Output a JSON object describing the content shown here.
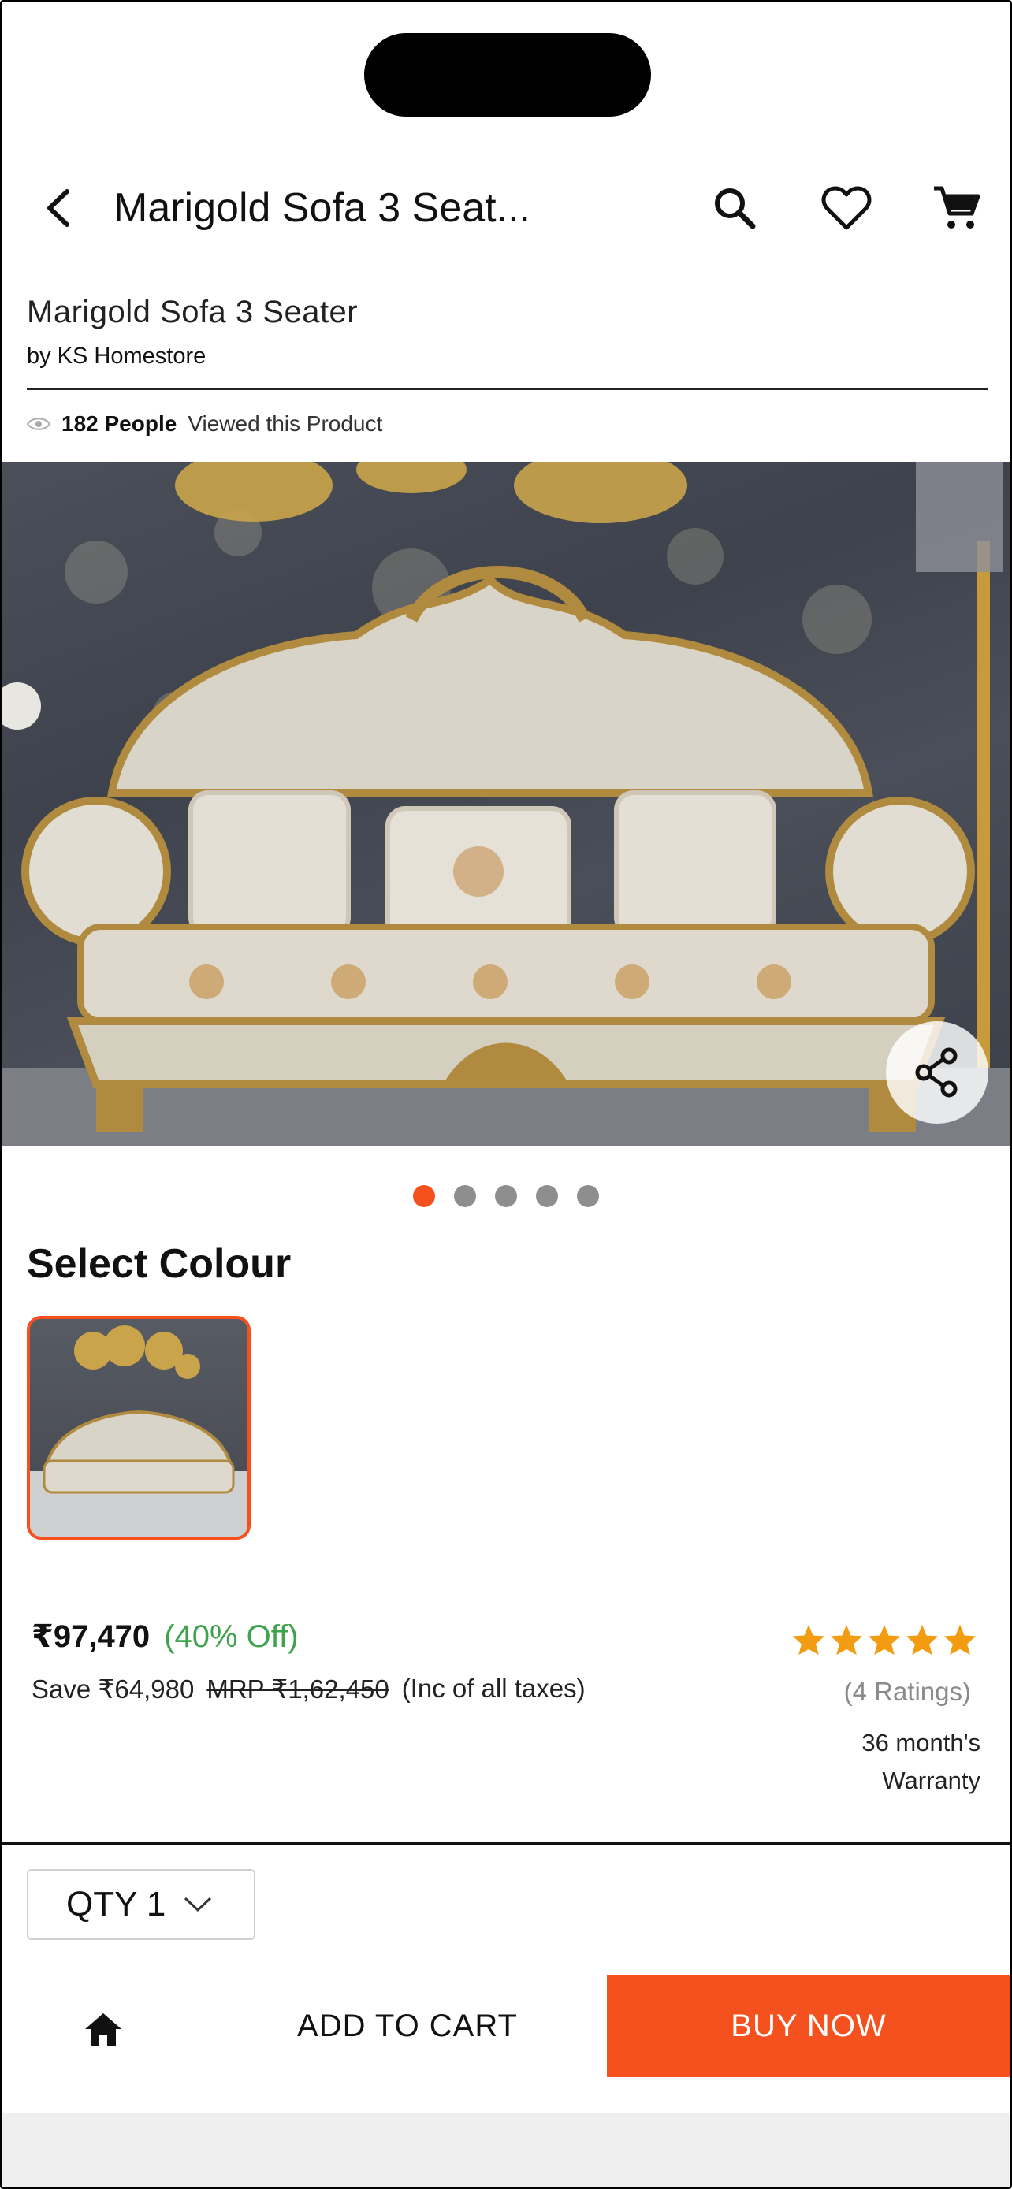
{
  "header": {
    "title": "Marigold Sofa 3 Seat...",
    "icons": [
      "back-arrow-icon",
      "search-icon",
      "heart-icon",
      "cart-icon"
    ]
  },
  "product": {
    "name": "Marigold Sofa 3 Seater",
    "brand": "by KS Homestore",
    "viewers_count": "182 People",
    "viewers_text": "Viewed this Product"
  },
  "gallery": {
    "image_description": "Ornate carved gold-trim 3-seater sofa with cream damask upholstery and three cushions against a dark textured wall",
    "total_images": 5,
    "active_index": 0
  },
  "colour": {
    "title": "Select Colour",
    "selected_index": 0
  },
  "pricing": {
    "price": "₹97,470",
    "discount": "(40% Off)",
    "save": "Save ₹64,980",
    "mrp": "MRP ₹1,62,450",
    "tax_note": "(Inc of all taxes)",
    "rating_stars": 5,
    "ratings_text": "(4 Ratings)",
    "warranty_line1": "36 month's",
    "warranty_line2": "Warranty"
  },
  "qty": {
    "label": "QTY 1"
  },
  "actions": {
    "add_to_cart": "ADD TO CART",
    "buy_now": "BUY NOW"
  },
  "colors": {
    "accent": "#f4511e",
    "discount_green": "#3fa34d",
    "star": "#f39c12",
    "dot_inactive": "#8e8e8e"
  }
}
